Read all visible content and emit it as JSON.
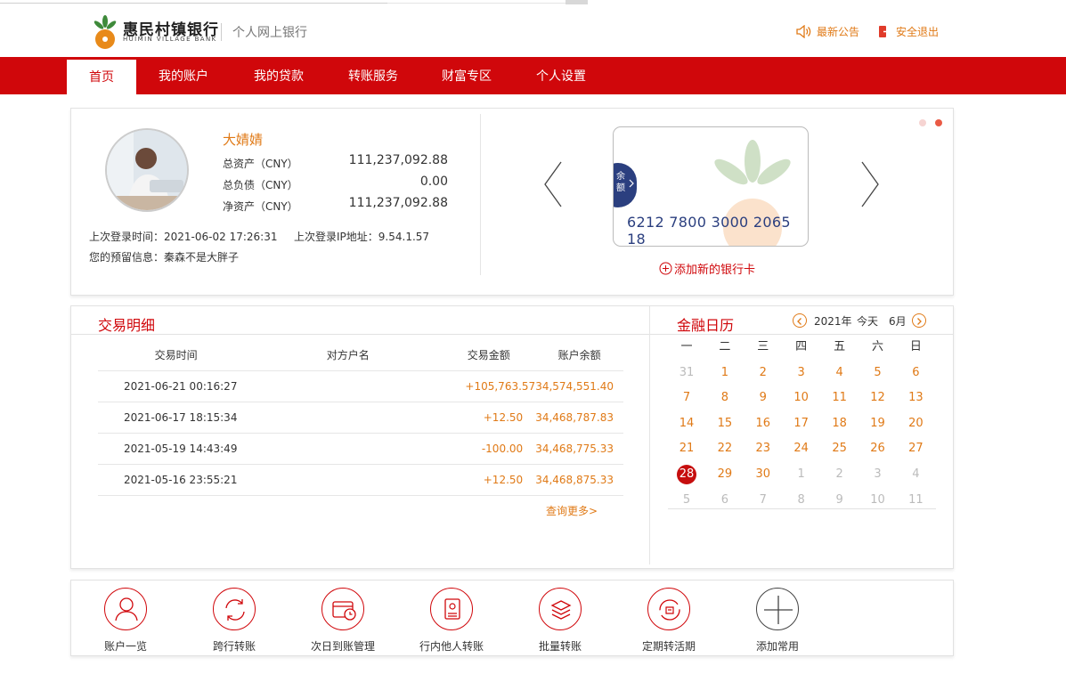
{
  "header": {
    "logo_cn": "惠民村镇银行",
    "logo_en": "HUIMIN VILLAGE BANK",
    "subtitle": "个人网上银行",
    "announce_label": "最新公告",
    "logout_label": "安全退出"
  },
  "nav": {
    "items": [
      {
        "label": "首页"
      },
      {
        "label": "我的账户"
      },
      {
        "label": "我的贷款"
      },
      {
        "label": "转账服务"
      },
      {
        "label": "财富专区"
      },
      {
        "label": "个人设置"
      }
    ]
  },
  "profile": {
    "name": "大婧婧",
    "total_assets_label": "总资产（CNY）",
    "total_assets": "111,237,092.88",
    "total_debt_label": "总负债（CNY）",
    "total_debt": "0.00",
    "net_assets_label": "净资产（CNY）",
    "net_assets": "111,237,092.88",
    "last_login_label": "上次登录时间：",
    "last_login": "2021-06-02 17:26:31",
    "last_ip_label": "上次登录IP地址：",
    "last_ip": "9.54.1.57",
    "reserved_label": "您的预留信息：",
    "reserved": "秦森不是大胖子"
  },
  "card": {
    "tag_line1": "余",
    "tag_line2": "额",
    "number": "6212 7800 3000 2065 18",
    "add_label": "添加新的银行卡"
  },
  "transactions": {
    "title": "交易明细",
    "columns": [
      "交易时间",
      "对方户名",
      "交易金额",
      "账户余额"
    ],
    "rows": [
      {
        "time": "2021-06-21 00:16:27",
        "party": "",
        "amount": "+105,763.57",
        "balance": "34,574,551.40"
      },
      {
        "time": "2021-06-17 18:15:34",
        "party": "",
        "amount": "+12.50",
        "balance": "34,468,787.83"
      },
      {
        "time": "2021-05-19 14:43:49",
        "party": "",
        "amount": "-100.00",
        "balance": "34,468,775.33"
      },
      {
        "time": "2021-05-16 23:55:21",
        "party": "",
        "amount": "+12.50",
        "balance": "34,468,875.33"
      }
    ],
    "more_label": "查询更多>"
  },
  "calendar": {
    "title": "金融日历",
    "year_label": "2021年",
    "today_label": "今天",
    "month_label": "6月",
    "weekdays": [
      "一",
      "二",
      "三",
      "四",
      "五",
      "六",
      "日"
    ],
    "weeks": [
      [
        {
          "d": "31",
          "t": "oth"
        },
        {
          "d": "1",
          "t": "cur"
        },
        {
          "d": "2",
          "t": "cur"
        },
        {
          "d": "3",
          "t": "cur"
        },
        {
          "d": "4",
          "t": "cur"
        },
        {
          "d": "5",
          "t": "cur"
        },
        {
          "d": "6",
          "t": "cur"
        }
      ],
      [
        {
          "d": "7",
          "t": "cur"
        },
        {
          "d": "8",
          "t": "cur"
        },
        {
          "d": "9",
          "t": "cur"
        },
        {
          "d": "10",
          "t": "cur"
        },
        {
          "d": "11",
          "t": "cur"
        },
        {
          "d": "12",
          "t": "cur"
        },
        {
          "d": "13",
          "t": "cur"
        }
      ],
      [
        {
          "d": "14",
          "t": "cur"
        },
        {
          "d": "15",
          "t": "cur"
        },
        {
          "d": "16",
          "t": "cur"
        },
        {
          "d": "17",
          "t": "cur"
        },
        {
          "d": "18",
          "t": "cur"
        },
        {
          "d": "19",
          "t": "cur"
        },
        {
          "d": "20",
          "t": "cur"
        }
      ],
      [
        {
          "d": "21",
          "t": "cur"
        },
        {
          "d": "22",
          "t": "cur"
        },
        {
          "d": "23",
          "t": "cur"
        },
        {
          "d": "24",
          "t": "cur"
        },
        {
          "d": "25",
          "t": "cur"
        },
        {
          "d": "26",
          "t": "cur"
        },
        {
          "d": "27",
          "t": "cur"
        }
      ],
      [
        {
          "d": "28",
          "t": "today"
        },
        {
          "d": "29",
          "t": "cur"
        },
        {
          "d": "30",
          "t": "cur"
        },
        {
          "d": "1",
          "t": "oth"
        },
        {
          "d": "2",
          "t": "oth"
        },
        {
          "d": "3",
          "t": "oth"
        },
        {
          "d": "4",
          "t": "oth"
        }
      ],
      [
        {
          "d": "5",
          "t": "oth"
        },
        {
          "d": "6",
          "t": "oth"
        },
        {
          "d": "7",
          "t": "oth"
        },
        {
          "d": "8",
          "t": "oth"
        },
        {
          "d": "9",
          "t": "oth"
        },
        {
          "d": "10",
          "t": "oth"
        },
        {
          "d": "11",
          "t": "oth"
        }
      ]
    ]
  },
  "quick_links": [
    {
      "label": "账户一览",
      "icon": "user-icon"
    },
    {
      "label": "跨行转账",
      "icon": "refresh-icon"
    },
    {
      "label": "次日到账管理",
      "icon": "clock-card-icon"
    },
    {
      "label": "行内他人转账",
      "icon": "document-icon"
    },
    {
      "label": "批量转账",
      "icon": "layers-icon"
    },
    {
      "label": "定期转活期",
      "icon": "cycle-icon"
    },
    {
      "label": "添加常用",
      "icon": "plus-icon"
    }
  ],
  "colors": {
    "brand_red": "#d0070b",
    "accent_orange": "#e07a17",
    "card_blue": "#2b3f7f"
  }
}
